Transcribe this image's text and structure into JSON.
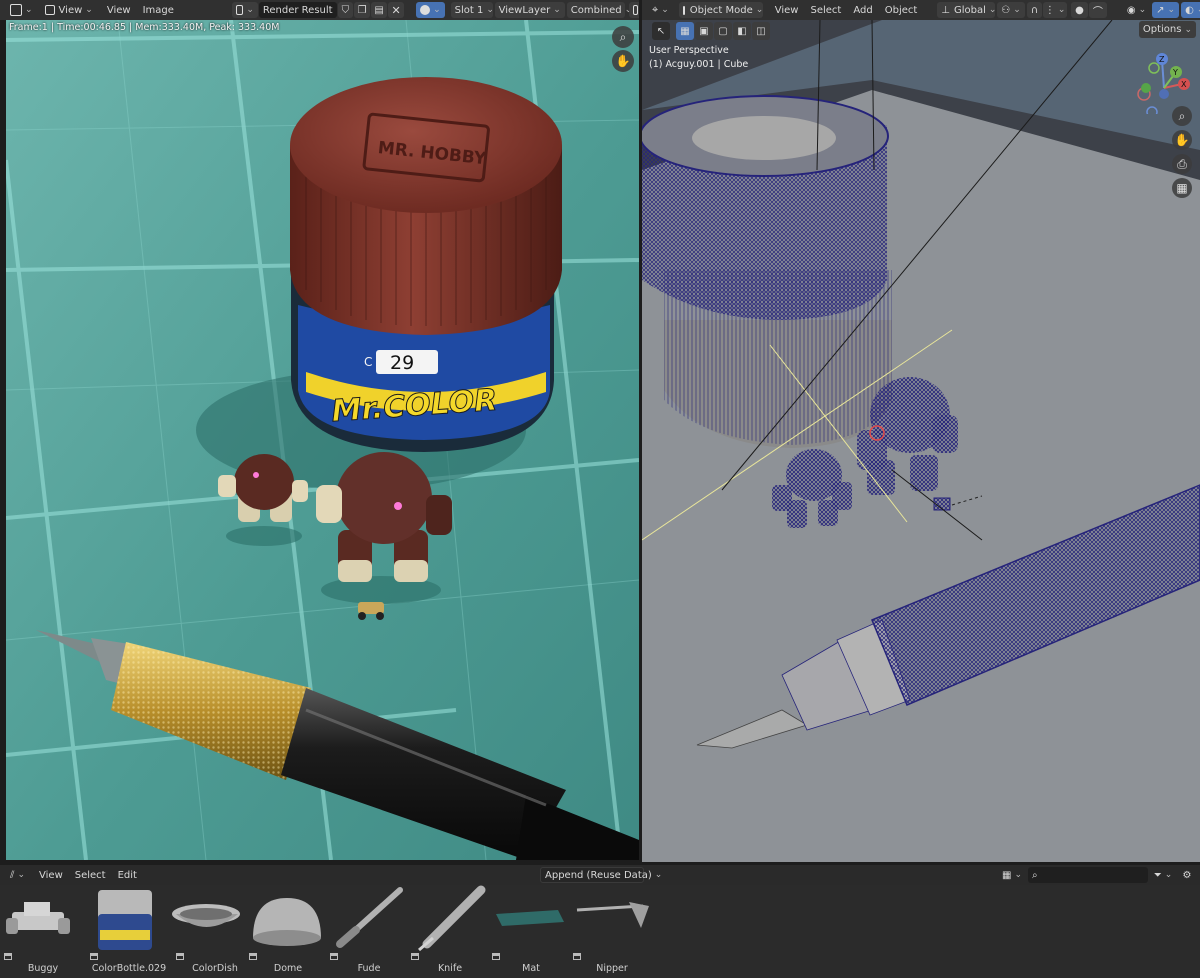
{
  "image_header": {
    "menus": [
      "View",
      "View",
      "Image"
    ],
    "image_name": "Render Result",
    "slot": "Slot 1",
    "view_layer": "ViewLayer",
    "pass": "Combined"
  },
  "render_info": "Frame:1 | Time:00:46.85 | Mem:333.40M, Peak: 333.40M",
  "viewport_header": {
    "mode": "Object Mode",
    "menus": [
      "View",
      "Select",
      "Add",
      "Object"
    ],
    "orientation": "Global",
    "options_label": "Options"
  },
  "viewport_overlay": {
    "perspective": "User Perspective",
    "object": "(1) Acguy.001 | Cube"
  },
  "gizmo": {
    "z": "Z",
    "y": "Y",
    "x": "X"
  },
  "render_text": {
    "brand": "Mr.COLOR",
    "lid_logo": "MR. HOBBY",
    "number_prefix": "C",
    "number": "29"
  },
  "asset_browser": {
    "menus": [
      "View",
      "Select",
      "Edit"
    ],
    "import_method": "Append (Reuse Data)",
    "assets": [
      "Buggy",
      "ColorBottle.029",
      "ColorDish",
      "Dome",
      "Fude",
      "Knife",
      "Mat",
      "Nipper"
    ]
  },
  "colors": {
    "accent": "#4772b3",
    "header": "#303030",
    "viewport_bg": "#3d4149",
    "mat": "#5aa79f",
    "wire": "#25237a"
  }
}
